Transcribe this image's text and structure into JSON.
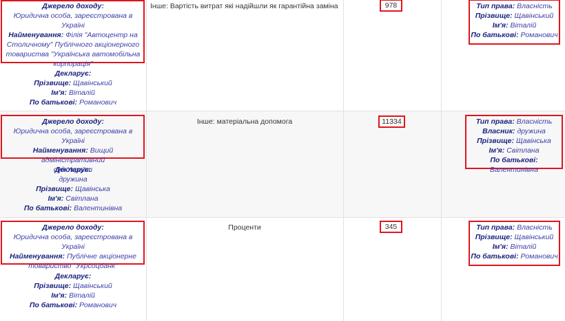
{
  "rows": [
    {
      "source": {
        "label": "Джерело доходу:",
        "type": "Юридична особа, зареєстрована в Україні",
        "name_label": "Найменування:",
        "name_lines": [
          "Філія \"Автоцентр на",
          "Столичному\" Публічного акціонерного",
          "товариства \"Українська автомобільна",
          "корпорація\""
        ]
      },
      "declarant": {
        "label": "Декларує:",
        "surname_label": "Прізвище:",
        "surname": "Щавінський",
        "name_label": "Ім'я:",
        "name": "Віталій",
        "patronymic_label": "По батькові:",
        "patronymic": "Романович"
      },
      "kind": "Інше: Вартість витрат які надійшли як гарантійна заміна",
      "amount": "978",
      "rights": [
        {
          "label": "Тип права:",
          "value": "Власність"
        },
        {
          "label": "Прізвище:",
          "value": "Щавінський"
        },
        {
          "label": "Ім'я:",
          "value": "Віталій"
        },
        {
          "label": "По батькові:",
          "value": "Романович"
        }
      ]
    },
    {
      "source": {
        "label": "Джерело доходу:",
        "type": "Юридична особа, зареєстрована в Україні",
        "name_label": "Найменування:",
        "name_lines": [
          "Вищий адміністративний",
          "суд України"
        ]
      },
      "declarant": {
        "label": "Декларує:",
        "relation": "дружина",
        "surname_label": "Прізвище:",
        "surname": "Щавінська",
        "name_label": "Ім'я:",
        "name": "Світлана",
        "patronymic_label": "По батькові:",
        "patronymic": "Валентинівна"
      },
      "kind": "Інше: матеріальна допомога",
      "amount": "11334",
      "rights": [
        {
          "label": "Тип права:",
          "value": "Власність"
        },
        {
          "label": "Власник:",
          "value": "дружина"
        },
        {
          "label": "Прізвище:",
          "value": "Щавінська"
        },
        {
          "label": "Ім'я:",
          "value": "Світлана"
        },
        {
          "label": "По батькові:",
          "value": "Валентинівна"
        }
      ]
    },
    {
      "source": {
        "label": "Джерело доходу:",
        "type": "Юридична особа, зареєстрована в Україні",
        "name_label": "Найменування:",
        "name_lines": [
          "Публічне акціонерне",
          "товариство \"Укрсоцбанк\""
        ]
      },
      "declarant": {
        "label": "Декларує:",
        "surname_label": "Прізвище:",
        "surname": "Щавінський",
        "name_label": "Ім'я:",
        "name": "Віталій",
        "patronymic_label": "По батькові:",
        "patronymic": "Романович"
      },
      "kind": "Проценти",
      "amount": "345",
      "rights": [
        {
          "label": "Тип права:",
          "value": "Власність"
        },
        {
          "label": "Прізвище:",
          "value": "Щавінський"
        },
        {
          "label": "Ім'я:",
          "value": "Віталій"
        },
        {
          "label": "По батькові:",
          "value": "Романович"
        }
      ]
    }
  ],
  "colors": {
    "highlight": "#e0141e",
    "label": "#1a237e",
    "value": "#3b3fa8"
  }
}
